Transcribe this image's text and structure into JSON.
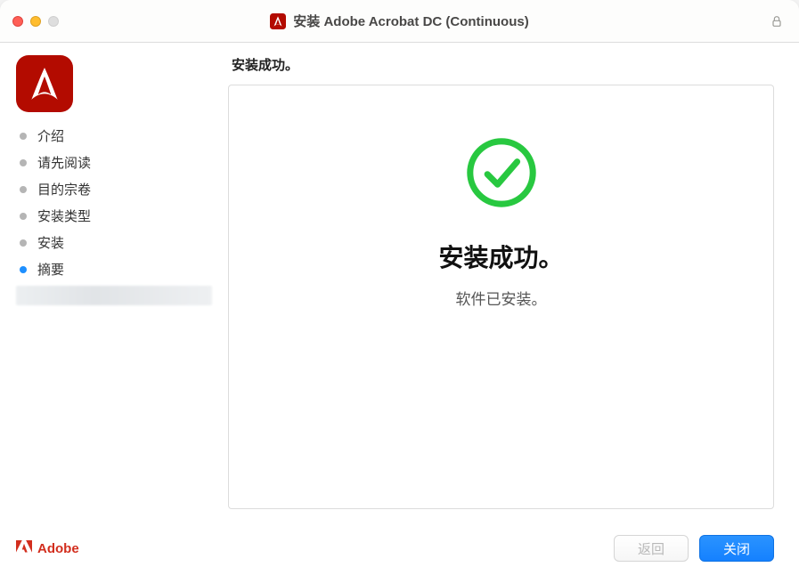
{
  "titlebar": {
    "title": "安装 Adobe Acrobat DC (Continuous)"
  },
  "sidebar": {
    "steps": [
      {
        "label": "介绍",
        "state": "done"
      },
      {
        "label": "请先阅读",
        "state": "done"
      },
      {
        "label": "目的宗卷",
        "state": "done"
      },
      {
        "label": "安装类型",
        "state": "done"
      },
      {
        "label": "安装",
        "state": "done"
      },
      {
        "label": "摘要",
        "state": "active"
      }
    ]
  },
  "main": {
    "heading": "安装成功。",
    "success_title": "安装成功。",
    "success_sub": "软件已安装。"
  },
  "footer": {
    "brand": "Adobe",
    "back": "返回",
    "close": "关闭"
  }
}
